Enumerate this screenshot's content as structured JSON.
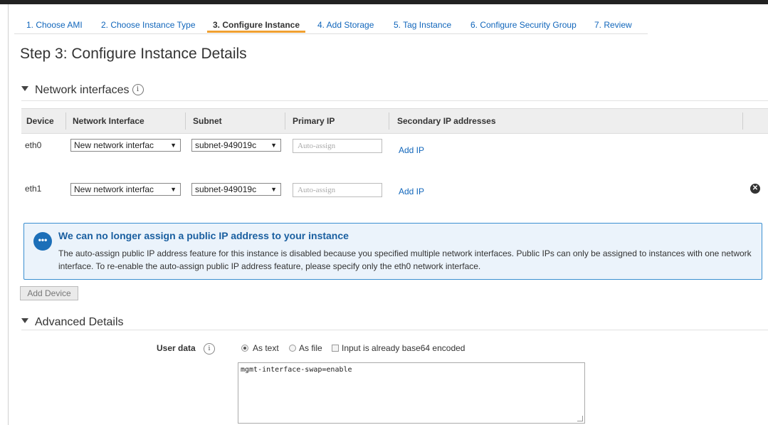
{
  "wizard": {
    "tabs": [
      {
        "label": "1. Choose AMI"
      },
      {
        "label": "2. Choose Instance Type"
      },
      {
        "label": "3. Configure Instance"
      },
      {
        "label": "4. Add Storage"
      },
      {
        "label": "5. Tag Instance"
      },
      {
        "label": "6. Configure Security Group"
      },
      {
        "label": "7. Review"
      }
    ],
    "active_index": 2
  },
  "page_title": "Step 3: Configure Instance Details",
  "network": {
    "section_title": "Network interfaces",
    "info_glyph": "i",
    "columns": [
      "Device",
      "Network Interface",
      "Subnet",
      "Primary IP",
      "Secondary IP addresses"
    ],
    "rows": [
      {
        "device": "eth0",
        "interface": "New network interfac",
        "subnet": "subnet-949019c",
        "primary_ip_placeholder": "Auto-assign",
        "add_ip": "Add IP"
      },
      {
        "device": "eth1",
        "interface": "New network interfac",
        "subnet": "subnet-949019c",
        "primary_ip_placeholder": "Auto-assign",
        "add_ip": "Add IP"
      }
    ],
    "dropdown_arrow": "▼",
    "remove_icon_glyph": "✕"
  },
  "notice": {
    "icon_glyph": "•••",
    "title": "We can no longer assign a public IP address to your instance",
    "body": "The auto-assign public IP address feature for this instance is disabled because you specified multiple network interfaces. Public IPs can only be assigned to instances with one network interface. To re-enable the auto-assign public IP address feature, please specify only the eth0 network interface.",
    "color": "#1a5fa0"
  },
  "add_device_label": "Add Device",
  "advanced": {
    "section_title": "Advanced Details",
    "user_data_label": "User data",
    "info_glyph": "i",
    "options": {
      "as_text": "As text",
      "as_file": "As file",
      "base64": "Input is already base64 encoded"
    },
    "selected": "As text",
    "user_data_value": "mgmt-interface-swap=enable"
  },
  "colors": {
    "link": "#1166bb",
    "active_tab_underline": "#f0a030",
    "header_bg": "#eeeeee"
  }
}
